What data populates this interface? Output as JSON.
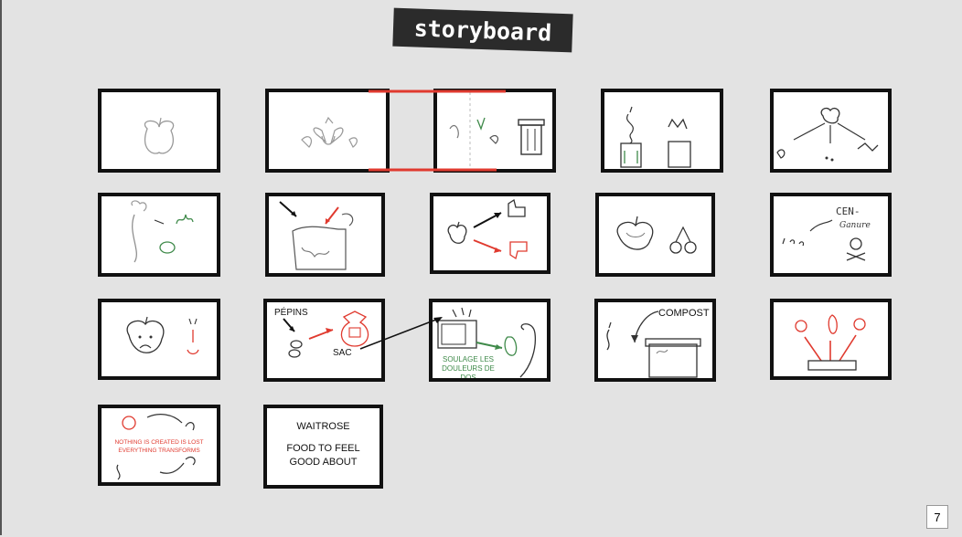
{
  "slide": {
    "title": "storyboard",
    "page_number": "7"
  },
  "colors": {
    "accent_red": "#e03a2f",
    "accent_green": "#3f8a4a",
    "pencil": "#8a8a8a",
    "frame": "#111111"
  },
  "panels": {
    "p12_label": "PÉPINS",
    "p12_label_2": "SAC",
    "p13_label": "SOULAGE LES DOULEURS DE DOS",
    "p14_label": "COMPOST",
    "p10_word": "CEN- Ganure",
    "p16_line1": "NOTHING IS CREATED IS LOST",
    "p16_line2": "EVERYTHING TRANSFORMS",
    "p17_line1": "WAITROSE",
    "p17_line2": "FOOD TO FEEL",
    "p17_line3": "GOOD ABOUT"
  }
}
